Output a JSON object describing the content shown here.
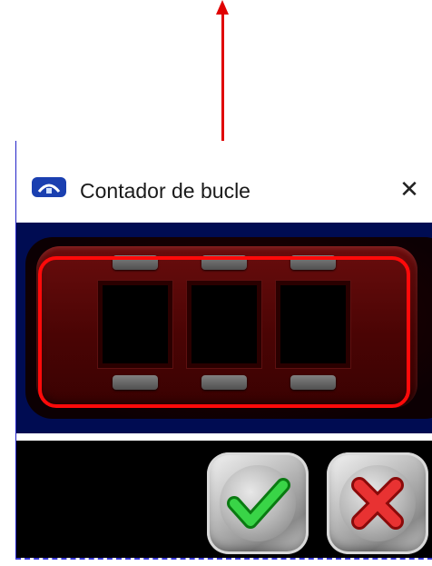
{
  "dialog": {
    "title": "Contador de bucle",
    "close_icon": "close-icon",
    "app_icon": "loop-counter-app-icon"
  },
  "counter": {
    "digits": [
      "",
      "",
      ""
    ],
    "indicator_icon": "led-indicator"
  },
  "buttons": {
    "ok_icon": "green-checkmark-icon",
    "cancel_icon": "red-x-icon"
  },
  "annotation": {
    "arrow_color": "#e00000",
    "highlight_color": "#ff0a0a"
  },
  "colors": {
    "panel": "#000c52",
    "counter_body": "#6a0d0d",
    "button_area": "#000000"
  }
}
